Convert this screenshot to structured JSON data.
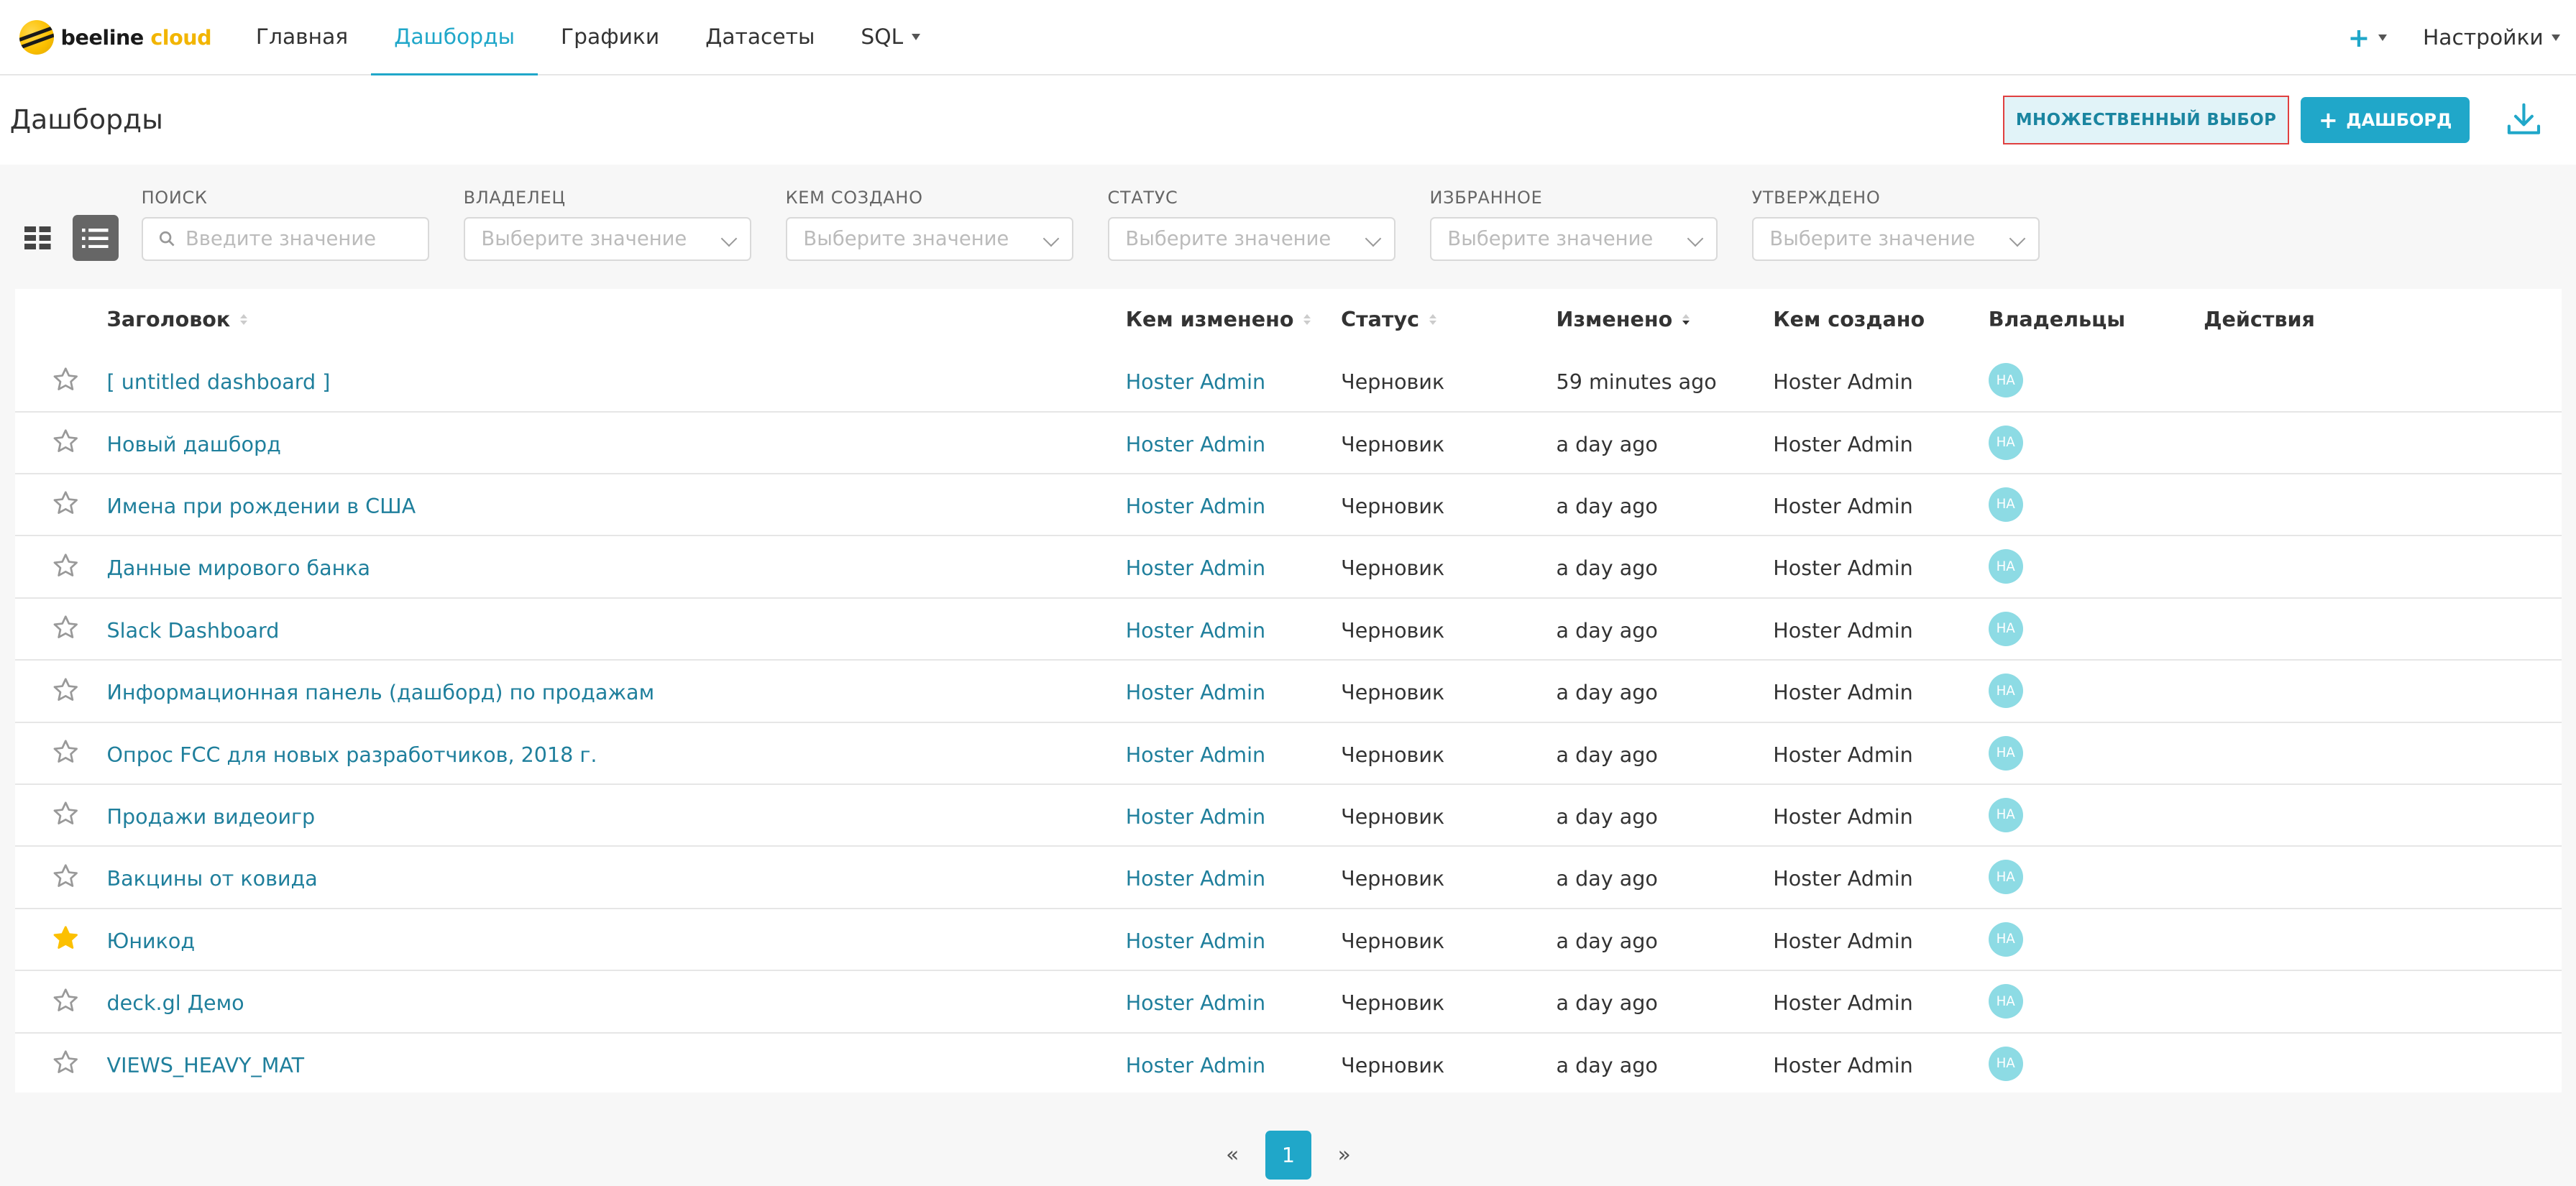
{
  "brand": {
    "word1": "beeline",
    "word2": "cloud"
  },
  "nav": {
    "items": [
      {
        "label": "Главная",
        "active": false
      },
      {
        "label": "Дашборды",
        "active": true
      },
      {
        "label": "Графики",
        "active": false
      },
      {
        "label": "Датасеты",
        "active": false
      },
      {
        "label": "SQL",
        "active": false,
        "dropdown": true
      }
    ],
    "plus_label": "+",
    "settings_label": "Настройки"
  },
  "header": {
    "title": "Дашборды",
    "multi_select_label": "МНОЖЕСТВЕННЫЙ ВЫБОР",
    "add_dashboard_label": "ДАШБОРД"
  },
  "filters": [
    {
      "label": "ПОИСК",
      "placeholder": "Введите значение",
      "type": "search"
    },
    {
      "label": "ВЛАДЕЛЕЦ",
      "placeholder": "Выберите значение",
      "type": "select"
    },
    {
      "label": "КЕМ СОЗДАНО",
      "placeholder": "Выберите значение",
      "type": "select"
    },
    {
      "label": "СТАТУС",
      "placeholder": "Выберите значение",
      "type": "select"
    },
    {
      "label": "ИЗБРАННОЕ",
      "placeholder": "Выберите значение",
      "type": "select"
    },
    {
      "label": "УТВЕРЖДЕНО",
      "placeholder": "Выберите значение",
      "type": "select"
    }
  ],
  "table": {
    "columns": [
      "Заголовок",
      "Кем изменено",
      "Статус",
      "Изменено",
      "Кем создано",
      "Владельцы",
      "Действия"
    ],
    "rows": [
      {
        "title": "[ untitled dashboard ]",
        "modified_by": "Hoster Admin",
        "status": "Черновик",
        "modified": "59 minutes ago",
        "created_by": "Hoster Admin",
        "owner": "HA",
        "favorite": false
      },
      {
        "title": "Новый дашборд",
        "modified_by": "Hoster Admin",
        "status": "Черновик",
        "modified": "a day ago",
        "created_by": "Hoster Admin",
        "owner": "HA",
        "favorite": false
      },
      {
        "title": "Имена при рождении в США",
        "modified_by": "Hoster Admin",
        "status": "Черновик",
        "modified": "a day ago",
        "created_by": "Hoster Admin",
        "owner": "HA",
        "favorite": false
      },
      {
        "title": "Данные мирового банка",
        "modified_by": "Hoster Admin",
        "status": "Черновик",
        "modified": "a day ago",
        "created_by": "Hoster Admin",
        "owner": "HA",
        "favorite": false
      },
      {
        "title": "Slack Dashboard",
        "modified_by": "Hoster Admin",
        "status": "Черновик",
        "modified": "a day ago",
        "created_by": "Hoster Admin",
        "owner": "HA",
        "favorite": false
      },
      {
        "title": "Информационная панель (дашборд) по продажам",
        "modified_by": "Hoster Admin",
        "status": "Черновик",
        "modified": "a day ago",
        "created_by": "Hoster Admin",
        "owner": "HA",
        "favorite": false
      },
      {
        "title": "Опрос FCC для новых разработчиков, 2018 г.",
        "modified_by": "Hoster Admin",
        "status": "Черновик",
        "modified": "a day ago",
        "created_by": "Hoster Admin",
        "owner": "HA",
        "favorite": false
      },
      {
        "title": "Продажи видеоигр",
        "modified_by": "Hoster Admin",
        "status": "Черновик",
        "modified": "a day ago",
        "created_by": "Hoster Admin",
        "owner": "HA",
        "favorite": false
      },
      {
        "title": "Вакцины от ковида",
        "modified_by": "Hoster Admin",
        "status": "Черновик",
        "modified": "a day ago",
        "created_by": "Hoster Admin",
        "owner": "HA",
        "favorite": false
      },
      {
        "title": "Юникод",
        "modified_by": "Hoster Admin",
        "status": "Черновик",
        "modified": "a day ago",
        "created_by": "Hoster Admin",
        "owner": "HA",
        "favorite": true
      },
      {
        "title": "deck.gl Демо",
        "modified_by": "Hoster Admin",
        "status": "Черновик",
        "modified": "a day ago",
        "created_by": "Hoster Admin",
        "owner": "HA",
        "favorite": false
      },
      {
        "title": "VIEWS_HEAVY_MAT",
        "modified_by": "Hoster Admin",
        "status": "Черновик",
        "modified": "a day ago",
        "created_by": "Hoster Admin",
        "owner": "HA",
        "favorite": false
      }
    ]
  },
  "pagination": {
    "prev": "«",
    "current": "1",
    "next": "»"
  },
  "colors": {
    "accent": "#20a7c9",
    "link": "#1f7f9c",
    "star_active": "#fcc000",
    "avatar": "#8ddbe4"
  }
}
